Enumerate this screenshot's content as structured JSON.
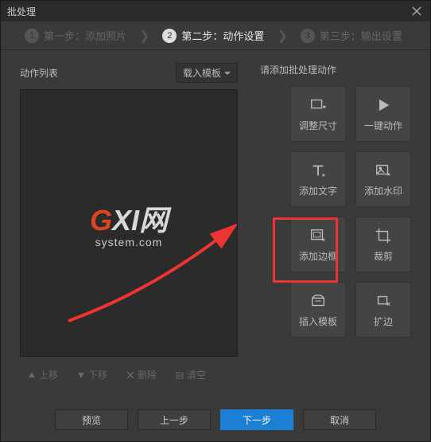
{
  "title": "批处理",
  "steps": {
    "s1": {
      "num": "1",
      "label": "第一步：添加照片"
    },
    "s2": {
      "num": "2",
      "label": "第二步：动作设置"
    },
    "s3": {
      "num": "3",
      "label": "第三步：输出设置"
    }
  },
  "left": {
    "label": "动作列表",
    "load_template": "载入模板",
    "watermark_main_a": "G",
    "watermark_main_b": "XI",
    "watermark_main_c": "网",
    "watermark_sub": "system.com",
    "up": "上移",
    "down": "下移",
    "delete": "删除",
    "clear": "清空"
  },
  "right": {
    "hint": "请添加批处理动作",
    "resize": "调整尺寸",
    "one_click": "一键动作",
    "add_text": "添加文字",
    "add_watermark": "添加水印",
    "add_border": "添加边框",
    "crop": "裁剪",
    "insert_template": "插入模板",
    "expand": "扩边"
  },
  "footer": {
    "preview": "预览",
    "prev": "上一步",
    "next": "下一步",
    "cancel": "取消"
  }
}
